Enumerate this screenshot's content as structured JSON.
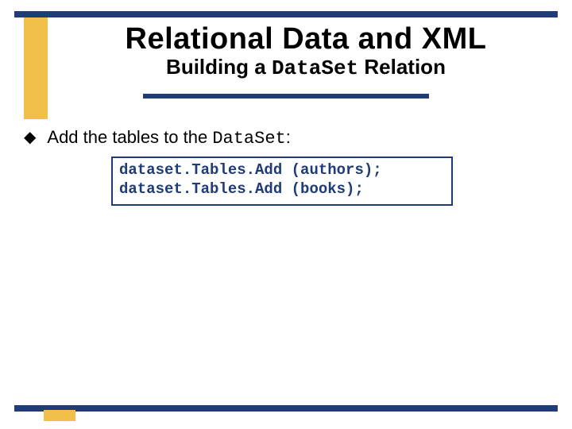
{
  "title": {
    "main": "Relational Data and XML",
    "sub_prefix": "Building a ",
    "sub_code": "DataSet",
    "sub_suffix": " Relation"
  },
  "bullet": {
    "glyph": "◆",
    "text_prefix": "Add the tables to the ",
    "text_code": "DataSet",
    "text_suffix": ":"
  },
  "code": {
    "line1": "dataset.Tables.Add (authors);",
    "line2": "dataset.Tables.Add (books);"
  }
}
